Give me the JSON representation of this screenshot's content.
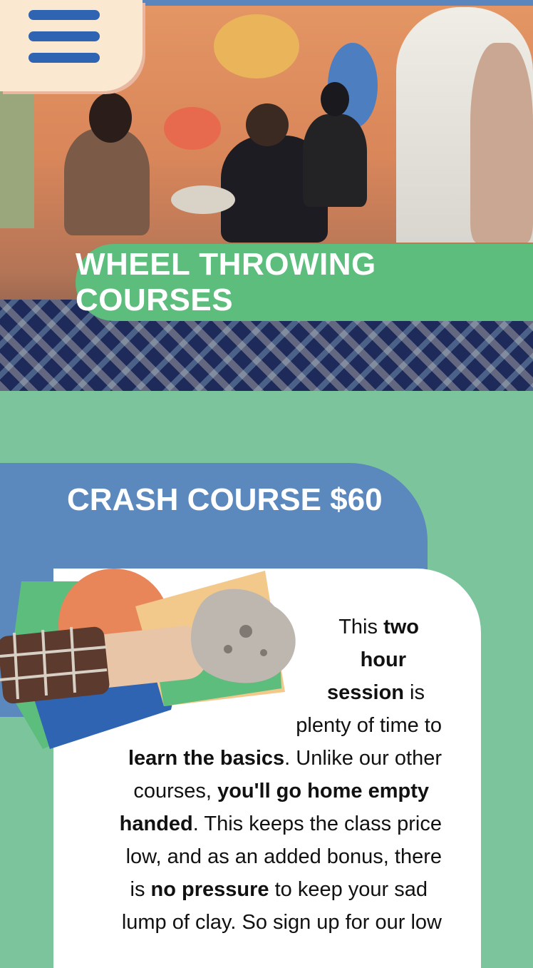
{
  "header": {
    "menu_icon": "hamburger-menu-icon"
  },
  "hero": {
    "title": "WHEEL THROWING COURSES",
    "image": "pottery-class-photo"
  },
  "course": {
    "title": "CRASH COURSE $60",
    "illustration": "hand-holding-clay",
    "paragraph": {
      "l1a": "This ",
      "l1b": "two",
      "l2": "hour",
      "l3a": "session",
      "l3b": " is",
      "l4": "plenty of time to",
      "l5a": "learn the basics",
      "l5b": ". Unlike our other",
      "l6a": "courses, ",
      "l6b": "you'll go home empty",
      "l7a": "handed",
      "l7b": ". This keeps the class price",
      "l8": "low, and as an added bonus, there",
      "l9a": "is ",
      "l9b": "no pressure",
      "l9c": " to keep your sad",
      "l10": "lump of clay. So sign up for our low"
    }
  },
  "colors": {
    "page_green": "#7cc59c",
    "banner_green": "#5cbd7d",
    "blue": "#5b88bd",
    "menu_bg": "#fbe8d0",
    "menu_lines": "#2f64b3"
  }
}
